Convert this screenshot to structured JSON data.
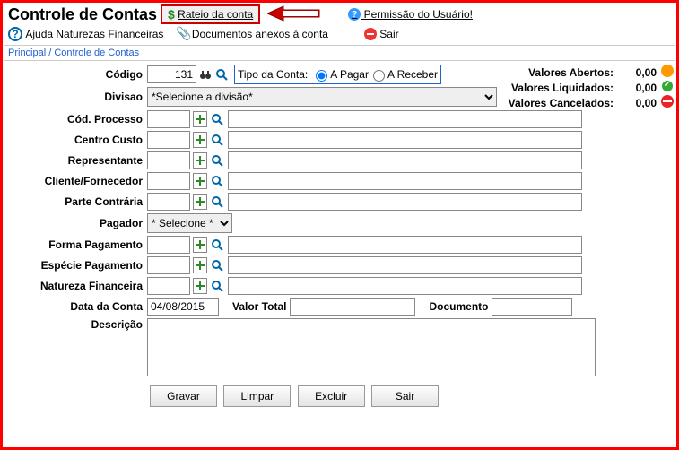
{
  "header": {
    "title": "Controle de Contas",
    "rateio": "Rateio da conta",
    "permissao": "Permissão do Usuário!",
    "ajuda": "Ajuda Naturezas Financeiras",
    "docs": "Documentos anexos à conta",
    "sair": "Sair"
  },
  "breadcrumb": "Principal / Controle de Contas",
  "labels": {
    "codigo": "Código",
    "tipo": "Tipo da Conta:",
    "aPagar": "A Pagar",
    "aReceber": "A Receber",
    "divisao": "Divisao",
    "codProcesso": "Cód. Processo",
    "centroCusto": "Centro Custo",
    "representante": "Representante",
    "clienteFornecedor": "Cliente/Fornecedor",
    "parteContraria": "Parte Contrária",
    "pagador": "Pagador",
    "formaPagamento": "Forma Pagamento",
    "especiePagamento": "Espécie Pagamento",
    "naturezaFinanceira": "Natureza Financeira",
    "dataConta": "Data da Conta",
    "valorTotal": "Valor Total",
    "documento": "Documento",
    "descricao": "Descrição"
  },
  "values": {
    "codigo": "131",
    "divisao": "*Selecione a divisão*",
    "pagador": "* Selecione *",
    "dataConta": "04/08/2015"
  },
  "valores": {
    "abertos_l": "Valores Abertos:",
    "abertos_v": "0,00",
    "liquidados_l": "Valores Liquidados:",
    "liquidados_v": "0,00",
    "cancelados_l": "Valores Cancelados:",
    "cancelados_v": "0,00"
  },
  "buttons": {
    "gravar": "Gravar",
    "limpar": "Limpar",
    "excluir": "Excluir",
    "sair": "Sair"
  }
}
